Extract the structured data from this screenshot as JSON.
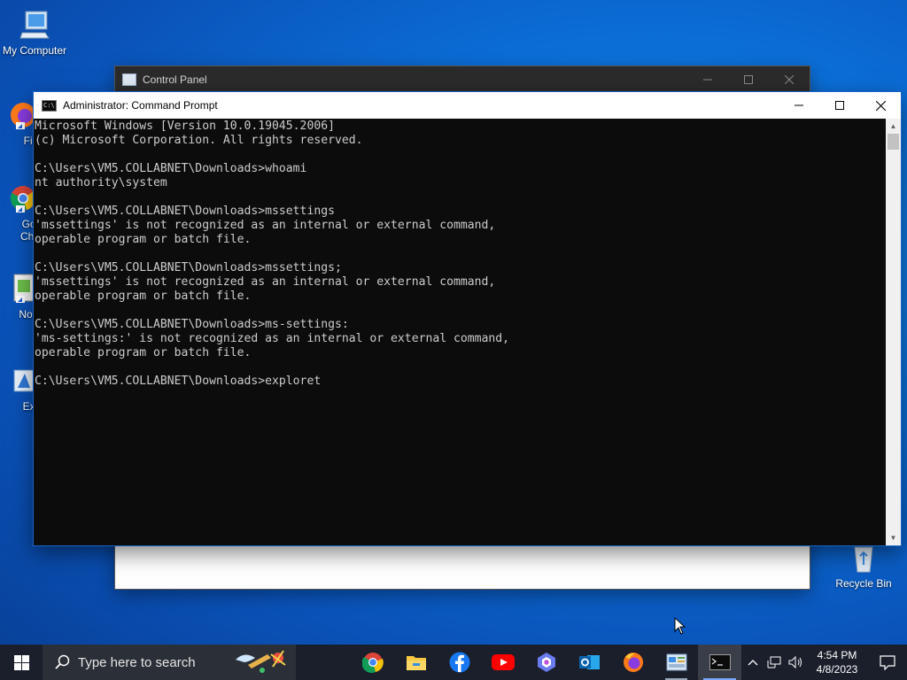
{
  "desktop": {
    "icons": [
      {
        "label": "My Computer"
      },
      {
        "label": "Fire"
      },
      {
        "label": "Goo\nChro"
      },
      {
        "label": "Note"
      },
      {
        "label": "Exe"
      },
      {
        "label": "Recycle Bin"
      }
    ]
  },
  "control_panel": {
    "title": "Control Panel"
  },
  "cmd": {
    "title": "Administrator: Command Prompt",
    "lines": [
      "Microsoft Windows [Version 10.0.19045.2006]",
      "(c) Microsoft Corporation. All rights reserved.",
      "",
      "C:\\Users\\VM5.COLLABNET\\Downloads>whoami",
      "nt authority\\system",
      "",
      "C:\\Users\\VM5.COLLABNET\\Downloads>mssettings",
      "'mssettings' is not recognized as an internal or external command,",
      "operable program or batch file.",
      "",
      "C:\\Users\\VM5.COLLABNET\\Downloads>mssettings;",
      "'mssettings' is not recognized as an internal or external command,",
      "operable program or batch file.",
      "",
      "C:\\Users\\VM5.COLLABNET\\Downloads>ms-settings:",
      "'ms-settings:' is not recognized as an internal or external command,",
      "operable program or batch file.",
      "",
      "C:\\Users\\VM5.COLLABNET\\Downloads>exploret"
    ]
  },
  "taskbar": {
    "search_placeholder": "Type here to search",
    "apps": [
      {
        "icon": "chrome-icon"
      },
      {
        "icon": "file-explorer-icon"
      },
      {
        "icon": "facebook-icon"
      },
      {
        "icon": "youtube-icon"
      },
      {
        "icon": "copilot-icon"
      },
      {
        "icon": "outlook-icon"
      },
      {
        "icon": "firefox-icon"
      },
      {
        "icon": "control-panel-icon"
      },
      {
        "icon": "command-prompt-icon"
      }
    ],
    "time": "4:54 PM",
    "date": "4/8/2023"
  }
}
